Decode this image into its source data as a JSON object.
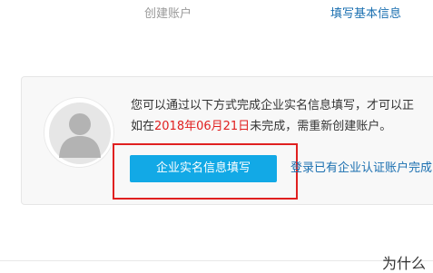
{
  "steps": {
    "previous": "创建账户",
    "current": "填写基本信息"
  },
  "notice": {
    "line1": "您可以通过以下方式完成企业实名信息填写，才可以正",
    "line2_prefix": "如在",
    "deadline": "2018年06月21日",
    "line2_suffix": "未完成，需重新创建账户。"
  },
  "actions": {
    "primary_button": "企业实名信息填写",
    "login_link": "登录已有企业认证账户完成"
  },
  "section": {
    "heading": "为什么"
  },
  "colors": {
    "accent_blue": "#12a9e6",
    "link_blue": "#1a6fb0",
    "deadline_red": "#e02020",
    "highlight_red": "#e02020"
  },
  "icons": {
    "avatar": "user-silhouette-icon"
  }
}
